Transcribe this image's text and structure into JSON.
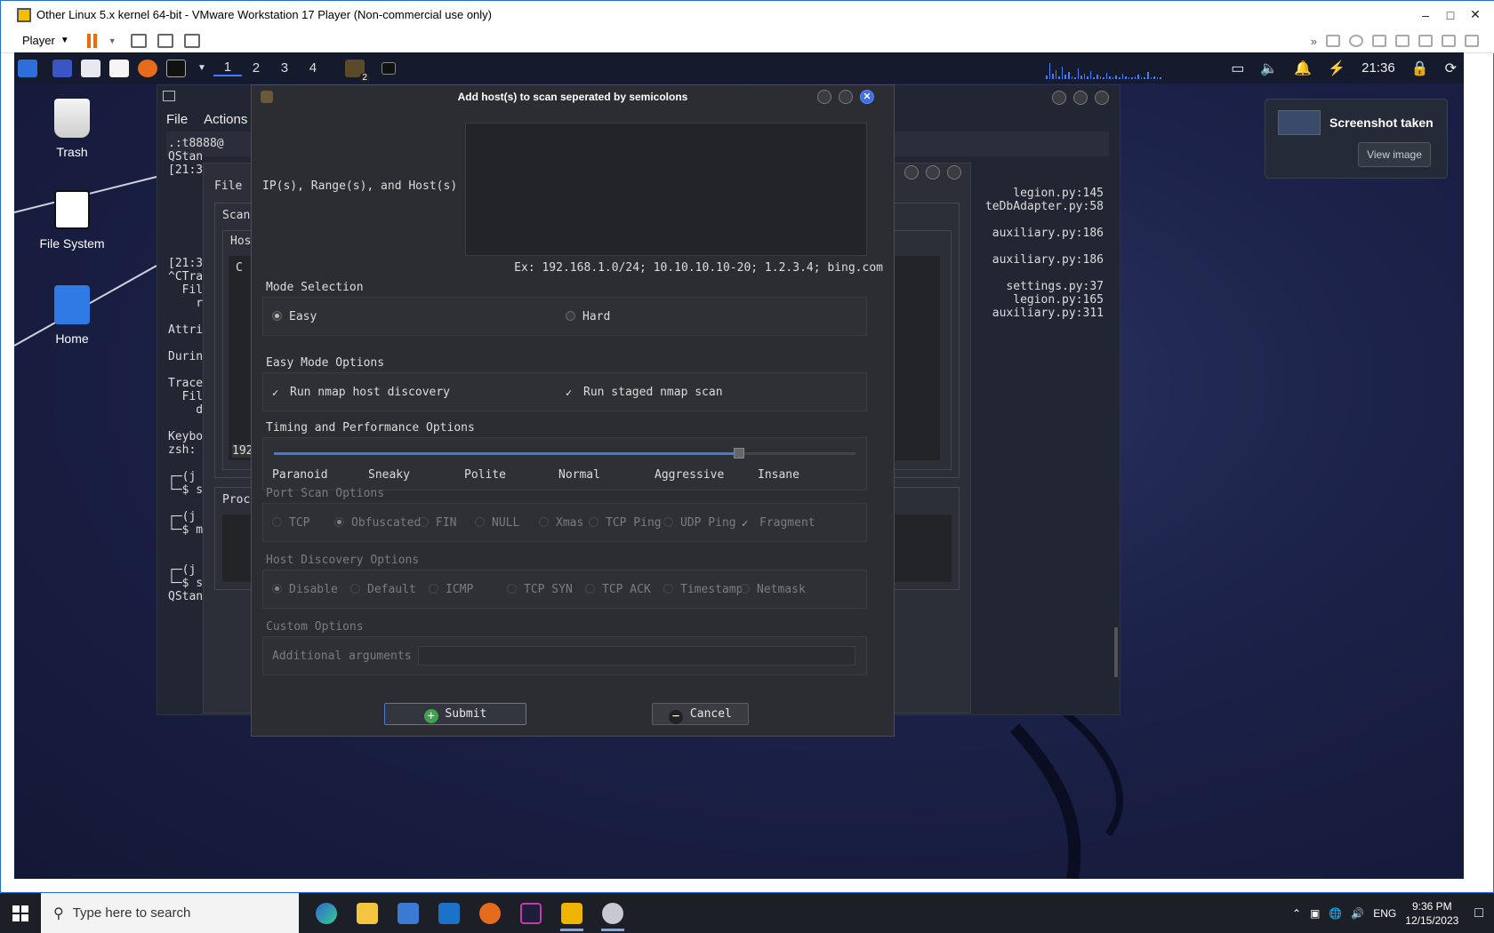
{
  "vmware": {
    "title": "Other Linux 5.x kernel 64-bit - VMware Workstation 17 Player (Non-commercial use only)",
    "player_label": "Player"
  },
  "guest_panel": {
    "workspaces": [
      "1",
      "2",
      "3",
      "4"
    ],
    "badge": "2",
    "clock": "21:36"
  },
  "desktop_icons": [
    "Trash",
    "File System",
    "Home"
  ],
  "notification": {
    "title": "Screenshot taken",
    "button": "View image"
  },
  "terminal": {
    "menu": [
      "File",
      "Actions"
    ],
    "lines": [
      ".:t8888@",
      "QStan",
      "[21:3",
      "",
      "",
      "",
      "",
      "",
      "",
      "[21:3",
      "^CTra",
      "  Fil",
      "    r",
      "",
      "Attri",
      "",
      "Durin",
      "",
      "Trace",
      "  Fil",
      "    d",
      "",
      "Keybo",
      "zsh:",
      "",
      "┌─(j",
      "└─$ s",
      "",
      "┌─(j",
      "└─$ m",
      "",
      "",
      "┌─(j",
      "└─$ sudo leg",
      "QStandardPat"
    ],
    "right_lines": [
      "legion.py:145",
      "teDbAdapter.py:58",
      "",
      "auxiliary.py:186",
      "",
      "auxiliary.py:186",
      "",
      "settings.py:37",
      "legion.py:165",
      "auxiliary.py:311"
    ]
  },
  "legion_bg": {
    "file": "File",
    "scan": "Scan",
    "hosts": "Hos",
    "c": "C",
    "ip": "192",
    "proc": "Proc"
  },
  "dialog": {
    "title": "Add host(s) to scan seperated by semicolons",
    "hosts_label": "IP(s), Range(s), and Host(s)",
    "hosts_value": "",
    "example": "Ex: 192.168.1.0/24; 10.10.10.10-20; 1.2.3.4; bing.com",
    "mode_title": "Mode Selection",
    "mode_easy": "Easy",
    "mode_hard": "Hard",
    "easy_title": "Easy Mode Options",
    "easy_opt1": "Run nmap host discovery",
    "easy_opt2": "Run staged nmap scan",
    "timing_title": "Timing and Performance Options",
    "timing_labels": [
      "Paranoid",
      "Sneaky",
      "Polite",
      "Normal",
      "Aggressive",
      "Insane"
    ],
    "timing_value_fraction": 0.8,
    "port_title": "Port Scan Options",
    "port_opts": [
      "TCP",
      "Obfuscated",
      "FIN",
      "NULL",
      "Xmas",
      "TCP Ping",
      "UDP Ping",
      "Fragment"
    ],
    "host_title": "Host Discovery Options",
    "host_opts": [
      "Disable",
      "Default",
      "ICMP",
      "TCP SYN",
      "TCP ACK",
      "Timestamp",
      "Netmask"
    ],
    "custom_title": "Custom Options",
    "custom_label": "Additional arguments",
    "custom_value": "",
    "submit": "Submit",
    "cancel": "Cancel"
  },
  "taskbar": {
    "search_placeholder": "Type here to search",
    "lang": "ENG",
    "time": "9:36 PM",
    "date": "12/15/2023"
  }
}
